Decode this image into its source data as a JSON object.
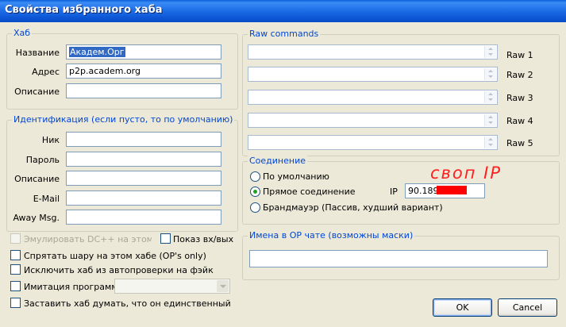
{
  "window": {
    "title": "Свойства избранного хаба"
  },
  "hub": {
    "legend": "Хаб",
    "name_label": "Название",
    "name_value": "Академ.Орг",
    "address_label": "Адрес",
    "address_value": "p2p.academ.org",
    "desc_label": "Описание",
    "desc_value": ""
  },
  "ident": {
    "legend": "Идентификация (если пусто, то по умолчанию)",
    "nick_label": "Ник",
    "nick_value": "",
    "pass_label": "Пароль",
    "pass_value": "",
    "desc_label": "Описание",
    "desc_value": "",
    "email_label": "E-Mail",
    "email_value": "",
    "away_label": "Away Msg.",
    "away_value": ""
  },
  "options": {
    "emulate_dc": "Эмулировать DC++ на этом хабе",
    "show_joins": "Показ вх/вых",
    "hide_share": "Спрятать шару на этом хабе (OP's only)",
    "exclude_check": "Исключить хаб из автопроверки на фэйк",
    "imitation": "Имитация программы",
    "imitation_value": "",
    "exclusive": "Заставить хаб думать, что он единственный"
  },
  "raw": {
    "legend": "Raw commands",
    "items": [
      {
        "label": "Raw 1",
        "value": ""
      },
      {
        "label": "Raw 2",
        "value": ""
      },
      {
        "label": "Raw 3",
        "value": ""
      },
      {
        "label": "Raw 4",
        "value": ""
      },
      {
        "label": "Raw 5",
        "value": ""
      }
    ]
  },
  "connection": {
    "legend": "Соединение",
    "default_label": "По умолчанию",
    "direct_label": "Прямое соединение",
    "firewall_label": "Брандмауэр (Пассив, худший вариант)",
    "selected": "direct",
    "ip_label": "IP",
    "ip_value": "90.189.",
    "annotation": "своп IP"
  },
  "opchat": {
    "legend": "Имена в OP чате (возможны маски)",
    "value": ""
  },
  "buttons": {
    "ok": "OK",
    "cancel": "Cancel"
  }
}
